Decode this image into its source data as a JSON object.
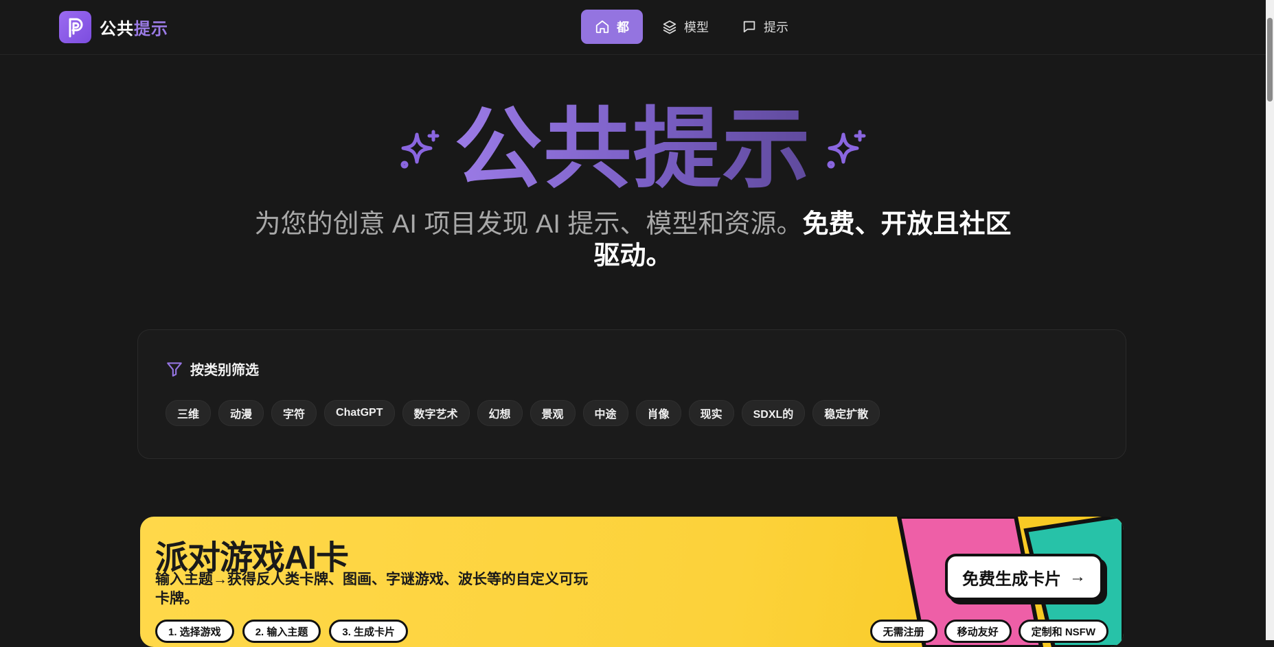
{
  "header": {
    "logo_text_a": "公共",
    "logo_text_b": "提示",
    "logo_icon": "p-logo-icon",
    "nav": [
      {
        "label": "都",
        "icon": "home-icon",
        "active": true
      },
      {
        "label": "模型",
        "icon": "layers-icon",
        "active": false
      },
      {
        "label": "提示",
        "icon": "chat-bubble-icon",
        "active": false
      }
    ]
  },
  "hero": {
    "title": "公共提示",
    "subtitle_normal": "为您的创意 AI 项目发现 AI 提示、模型和资源。",
    "subtitle_bold": "免费、开放且社区驱动。",
    "icon": "sparkle-icon"
  },
  "filter": {
    "heading": "按类别筛选",
    "icon": "filter-icon",
    "chips": [
      "三维",
      "动漫",
      "字符",
      "ChatGPT",
      "数字艺术",
      "幻想",
      "景观",
      "中途",
      "肖像",
      "现实",
      "SDXL的",
      "稳定扩散"
    ]
  },
  "banner": {
    "title": "派对游戏AI卡",
    "subtitle": "输入主题→获得反人类卡牌、图画、字谜游戏、波长等的自定义可玩卡牌。",
    "steps": [
      "1. 选择游戏",
      "2. 输入主题",
      "3. 生成卡片"
    ],
    "cta": "免费生成卡片",
    "cta_arrow": "→",
    "features": [
      "无需注册",
      "移动友好",
      "定制和 NSFW"
    ]
  },
  "colors": {
    "accent": "#9474e0",
    "background": "#181818",
    "banner_yellow": "#fcd23a",
    "banner_pink": "#ee5fa7",
    "banner_teal": "#27c2a8"
  }
}
